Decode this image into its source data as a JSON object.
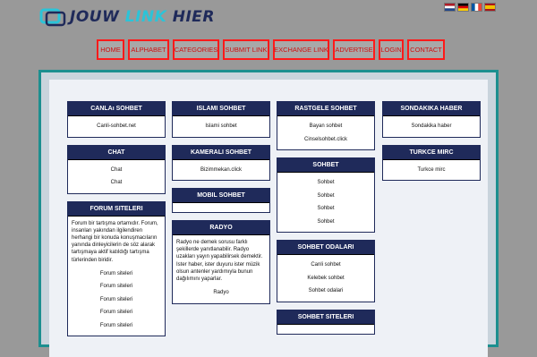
{
  "brand": {
    "word1": "JOUW",
    "word2": "LINK",
    "word3": "HIER"
  },
  "flags": [
    "netherlands-flag",
    "germany-flag",
    "france-flag",
    "spain-flag"
  ],
  "nav": [
    "HOME",
    "ALPHABET",
    "CATEGORIES",
    "SUBMIT LINK",
    "EXCHANGE LINK",
    "ADVERTISE",
    "LOGIN",
    "CONTACT"
  ],
  "colors": {
    "navy": "#1f2a5a",
    "teal": "#1c8f8f",
    "cyan": "#2bc4d8",
    "nav_border": "#ff1a1a",
    "nav_text": "#d01010"
  },
  "columns": [
    [
      {
        "title": "CANLAı SOHBET",
        "links": [
          "Canli-sohbet.net"
        ]
      },
      {
        "title": "CHAT",
        "links": [
          "Chat",
          "Chat"
        ]
      },
      {
        "title": "FORUM SITELERI",
        "desc": "Forum bir tartışma ortamıdır. Forum, insanları yakından ilgilendiren herhangi bir konuda konuşmacıların yanında dinleyicilerin de söz alarak tartışmaya aktif katıldığı tartışma türlerinden biridir.",
        "links": [
          "Forum siteleri",
          "Forum siteleri",
          "Forum siteleri",
          "Forum siteleri",
          "Forum siteleri"
        ]
      }
    ],
    [
      {
        "title": "ISLAMI SOHBET",
        "links": [
          "Islami sohbet"
        ]
      },
      {
        "title": "KAMERALI SOHBET",
        "links": [
          "Bizimmekan.click"
        ]
      },
      {
        "title": "MOBIL SOHBET",
        "links": []
      },
      {
        "title": "RADYO",
        "desc": "Radyo ne demek sorusu farklı şekillerde yanıtlanabilir. Radyo uzakları yayın yapabilirsek demektir. Ister haber, ister duyuru ister müzik olsun antenler yardımıyla bunun dağılımını yaparlar.",
        "links": [
          "Radyo"
        ]
      }
    ],
    [
      {
        "title": "RASTGELE SOHBET",
        "links": [
          "Bayan sohbet",
          "Cinselsohbet.click"
        ]
      },
      {
        "title": "SOHBET",
        "links": [
          "Sohbet",
          "Sohbet",
          "Sohbet",
          "Sohbet"
        ]
      },
      {
        "title": "SOHBET ODALARI",
        "links": [
          "Canli sohbet",
          "Kelebek sohbet",
          "Sohbet odalari"
        ]
      },
      {
        "title": "SOHBET SITELERI",
        "links": []
      }
    ],
    [
      {
        "title": "SONDAKIKA HABER",
        "links": [
          "Sondakika haber"
        ]
      },
      {
        "title": "TURKCE MIRC",
        "links": [
          "Turkce mirc"
        ]
      }
    ]
  ]
}
